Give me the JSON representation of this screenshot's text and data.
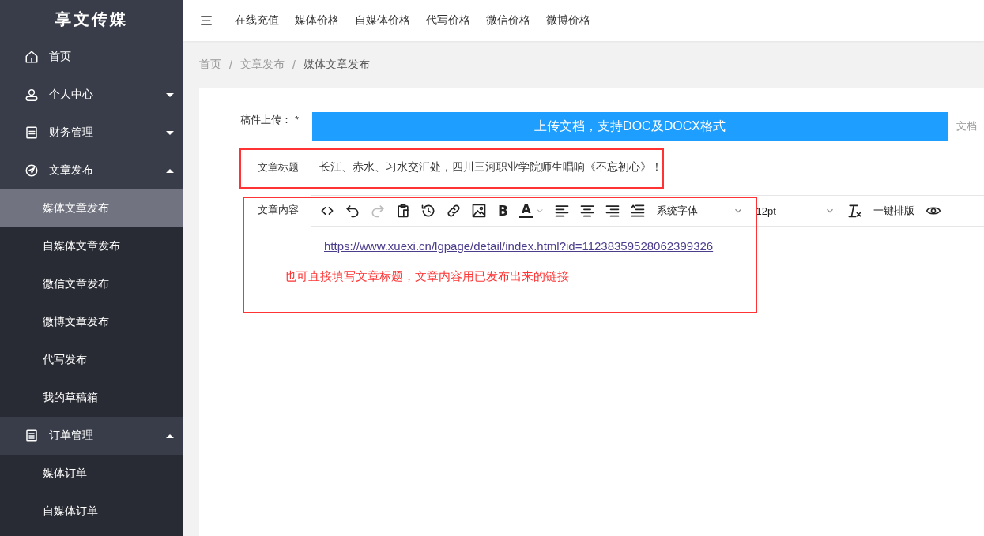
{
  "sidebar": {
    "logo": "享文传媒",
    "items": [
      {
        "label": "首页",
        "kind": "link"
      },
      {
        "label": "个人中心",
        "kind": "group",
        "expanded": false
      },
      {
        "label": "财务管理",
        "kind": "group",
        "expanded": false
      },
      {
        "label": "文章发布",
        "kind": "group",
        "expanded": true,
        "children": [
          {
            "label": "媒体文章发布",
            "selected": true
          },
          {
            "label": "自媒体文章发布",
            "selected": false
          },
          {
            "label": "微信文章发布",
            "selected": false
          },
          {
            "label": "微博文章发布",
            "selected": false
          },
          {
            "label": "代写发布",
            "selected": false
          },
          {
            "label": "我的草稿箱",
            "selected": false
          }
        ]
      },
      {
        "label": "订单管理",
        "kind": "group",
        "expanded": true,
        "children": [
          {
            "label": "媒体订单",
            "selected": false
          },
          {
            "label": "自媒体订单",
            "selected": false
          }
        ]
      }
    ]
  },
  "top_nav": [
    "在线充值",
    "媒体价格",
    "自媒体价格",
    "代写价格",
    "微信价格",
    "微博价格"
  ],
  "breadcrumb": {
    "items": [
      "首页",
      "文章发布",
      "媒体文章发布"
    ],
    "separators": [
      "/",
      "/"
    ]
  },
  "upload": {
    "label": "稿件上传：",
    "required_mark": "*",
    "button": "上传文档，支持DOC及DOCX格式",
    "hint": "文档"
  },
  "title_field": {
    "label": "文章标题",
    "value": "长江、赤水、习水交汇处，四川三河职业学院师生唱响《不忘初心》！"
  },
  "content_editor": {
    "label": "文章内容",
    "toolbar": [
      {
        "kind": "code",
        "disabled": false
      },
      {
        "kind": "undo",
        "disabled": false
      },
      {
        "kind": "redo",
        "disabled": true
      },
      {
        "kind": "paste",
        "disabled": false
      },
      {
        "kind": "history",
        "disabled": false
      },
      {
        "kind": "link",
        "disabled": false
      },
      {
        "kind": "image",
        "disabled": false
      },
      {
        "kind": "bold",
        "glyph": "B",
        "disabled": false
      },
      {
        "kind": "forecolor",
        "glyph": "A",
        "disabled": false
      },
      {
        "kind": "align-left",
        "disabled": false
      },
      {
        "kind": "align-center",
        "disabled": false
      },
      {
        "kind": "align-right",
        "disabled": false
      },
      {
        "kind": "line-height",
        "disabled": false
      },
      {
        "kind": "select",
        "value": "系统字体"
      },
      {
        "kind": "select",
        "value": "12pt"
      },
      {
        "kind": "clear-format",
        "disabled": false
      },
      {
        "kind": "text",
        "label": "一键排版"
      },
      {
        "kind": "preview",
        "disabled": false
      }
    ],
    "link": "https://www.xuexi.cn/lgpage/detail/index.html?id=11238359528062399326"
  },
  "annotation": {
    "note": "也可直接填写文章标题，文章内容用已发布出来的链接"
  }
}
